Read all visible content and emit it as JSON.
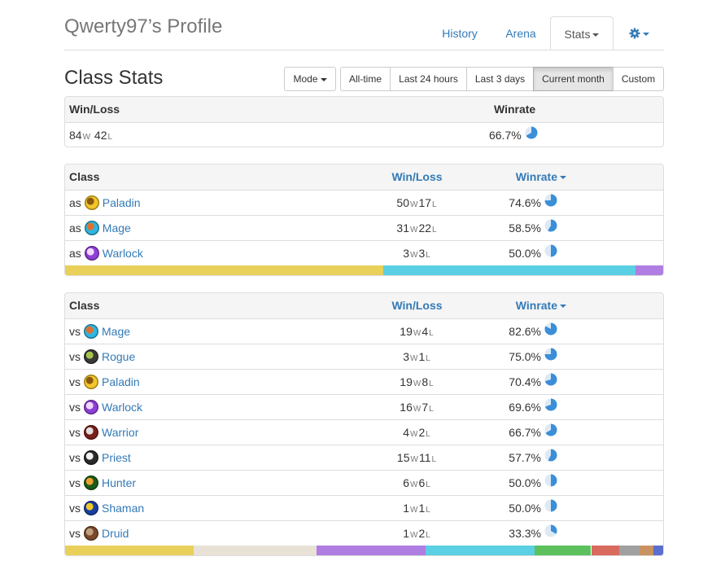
{
  "header": {
    "title": "Qwerty97’s Profile",
    "tabs": [
      {
        "label": "History",
        "active": false
      },
      {
        "label": "Arena",
        "active": false
      },
      {
        "label": "Stats",
        "active": true,
        "dropdown": true
      },
      {
        "label": "",
        "icon": "gear-icon",
        "dropdown": true
      }
    ]
  },
  "section": {
    "title": "Class Stats",
    "mode_label": "Mode",
    "time_filters": [
      {
        "label": "All-time",
        "active": false
      },
      {
        "label": "Last 24 hours",
        "active": false
      },
      {
        "label": "Last 3 days",
        "active": false
      },
      {
        "label": "Current month",
        "active": true
      },
      {
        "label": "Custom",
        "active": false
      }
    ]
  },
  "summary": {
    "col_winloss": "Win/Loss",
    "col_winrate": "Winrate",
    "wins": "84",
    "losses": "42",
    "winrate": "66.7%",
    "winrate_fraction": 0.667
  },
  "suffix_w": "W",
  "suffix_l": "L",
  "as_table": {
    "col_class": "Class",
    "col_winloss": "Win/Loss",
    "col_winrate": "Winrate",
    "prefix": "as",
    "rows": [
      {
        "class": "Paladin",
        "icon": "paladin-icon",
        "wins": "50",
        "losses": "17",
        "winrate": "74.6%",
        "fraction": 0.746
      },
      {
        "class": "Mage",
        "icon": "mage-icon",
        "wins": "31",
        "losses": "22",
        "winrate": "58.5%",
        "fraction": 0.585
      },
      {
        "class": "Warlock",
        "icon": "warlock-icon",
        "wins": "3",
        "losses": "3",
        "winrate": "50.0%",
        "fraction": 0.5
      }
    ],
    "distribution": [
      {
        "class": "Paladin",
        "fraction": 0.5319,
        "color": "#e8d05a"
      },
      {
        "class": "Mage",
        "fraction": 0.4219,
        "color": "#5bcfe3"
      },
      {
        "class": "Warlock",
        "fraction": 0.0462,
        "color": "#b07de3"
      }
    ]
  },
  "vs_table": {
    "col_class": "Class",
    "col_winloss": "Win/Loss",
    "col_winrate": "Winrate",
    "prefix": "vs",
    "rows": [
      {
        "class": "Mage",
        "icon": "mage-icon",
        "wins": "19",
        "losses": "4",
        "winrate": "82.6%",
        "fraction": 0.826
      },
      {
        "class": "Rogue",
        "icon": "rogue-icon",
        "wins": "3",
        "losses": "1",
        "winrate": "75.0%",
        "fraction": 0.75
      },
      {
        "class": "Paladin",
        "icon": "paladin-icon",
        "wins": "19",
        "losses": "8",
        "winrate": "70.4%",
        "fraction": 0.704
      },
      {
        "class": "Warlock",
        "icon": "warlock-icon",
        "wins": "16",
        "losses": "7",
        "winrate": "69.6%",
        "fraction": 0.696
      },
      {
        "class": "Warrior",
        "icon": "warrior-icon",
        "wins": "4",
        "losses": "2",
        "winrate": "66.7%",
        "fraction": 0.667
      },
      {
        "class": "Priest",
        "icon": "priest-icon",
        "wins": "15",
        "losses": "11",
        "winrate": "57.7%",
        "fraction": 0.577
      },
      {
        "class": "Hunter",
        "icon": "hunter-icon",
        "wins": "6",
        "losses": "6",
        "winrate": "50.0%",
        "fraction": 0.5
      },
      {
        "class": "Shaman",
        "icon": "shaman-icon",
        "wins": "1",
        "losses": "1",
        "winrate": "50.0%",
        "fraction": 0.5
      },
      {
        "class": "Druid",
        "icon": "druid-icon",
        "wins": "1",
        "losses": "2",
        "winrate": "33.3%",
        "fraction": 0.333
      }
    ],
    "distribution": [
      {
        "class": "Paladin",
        "fraction": 0.2146,
        "color": "#e8d05a"
      },
      {
        "class": "Priest",
        "fraction": 0.2064,
        "color": "#e8e2d6"
      },
      {
        "class": "Warlock",
        "fraction": 0.1818,
        "color": "#b07de3"
      },
      {
        "class": "Mage",
        "fraction": 0.1818,
        "color": "#5bcfe3"
      },
      {
        "class": "Hunter",
        "fraction": 0.095,
        "color": "#5cc15c"
      },
      {
        "class": "Warrior",
        "fraction": 0.0475,
        "color": "#d96a5e"
      },
      {
        "class": "Rogue",
        "fraction": 0.0339,
        "color": "#a0a0a0"
      },
      {
        "class": "Druid",
        "fraction": 0.0231,
        "color": "#c99262"
      },
      {
        "class": "Shaman",
        "fraction": 0.0159,
        "color": "#5a6fd0"
      }
    ]
  },
  "colors": {
    "link": "#337ab7",
    "pie_fill": "#3a8fd8",
    "pie_bg": "#dde9f4"
  }
}
